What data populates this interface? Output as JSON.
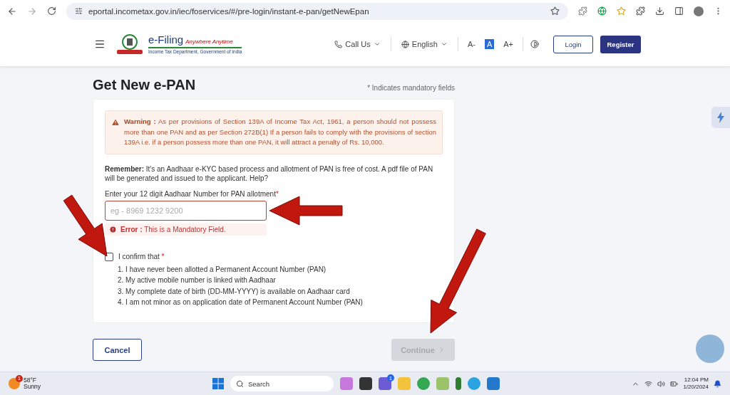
{
  "browser": {
    "url": "eportal.incometax.gov.in/iec/foservices/#/pre-login/instant-e-pan/getNewEpan"
  },
  "header": {
    "logo_title": "e-Filing",
    "logo_tagline": "Anywhere Anytime",
    "logo_subtitle": "Income Tax Department, Government of India",
    "call_us": "Call Us",
    "language": "English",
    "font_sizes": [
      {
        "label": "A-",
        "selected": false
      },
      {
        "label": "A",
        "selected": true
      },
      {
        "label": "A+",
        "selected": false
      }
    ],
    "login": "Login",
    "register": "Register"
  },
  "page": {
    "title": "Get New e-PAN",
    "mandatory_note": "Indicates mandatory fields",
    "required_mark": "*"
  },
  "warning": {
    "label": "Warning :",
    "text": "As per provisions of Section 139A of Income Tax Act, 1961, a person should not possess more than one PAN and as per Section 272B(1) If a person fails to comply with the provisions of section 139A i.e. if a person possess more than one PAN, it will attract a penalty of Rs. 10,000."
  },
  "remember": {
    "label": "Remember:",
    "text": "It's an Aadhaar e-KYC based process and allotment of PAN is free of cost. A pdf file of PAN will be generated and issued to the applicant.",
    "link": "Help?"
  },
  "aadhaar_field": {
    "label": "Enter your 12 digit Aadhaar Number for PAN allotment",
    "required_mark": "*",
    "placeholder": "eg - 8969 1232 9200",
    "error_label": "Error :",
    "error_text": "This is a Mandatory Field."
  },
  "confirm": {
    "label": "I confirm that",
    "required_mark": "*",
    "checked": false,
    "items": [
      "1. I have never been allotted a Permanent Account Number (PAN)",
      "2. My active mobile number is linked with Aadhaar",
      "3. My complete date of birth (DD-MM-YYYY) is available on Aadhaar card",
      "4. I am not minor as on application date of Permanent Account Number (PAN)"
    ]
  },
  "actions": {
    "cancel": "Cancel",
    "continue": {
      "label": "Continue",
      "disabled": true
    }
  },
  "taskbar": {
    "weather_badge": "1",
    "temperature": "58°F",
    "condition": "Sunny",
    "search": "Search",
    "chat_badge": "1",
    "time": "12:04 PM",
    "date": "1/20/2024"
  }
}
